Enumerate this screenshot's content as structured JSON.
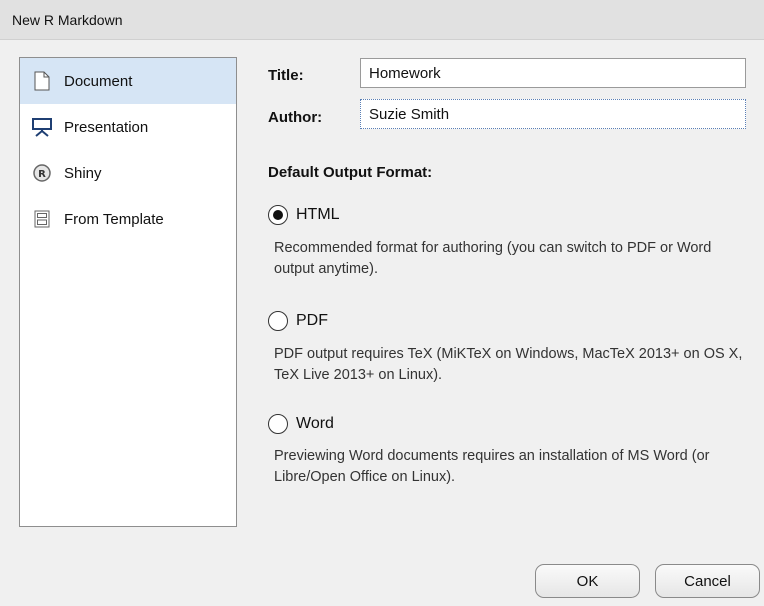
{
  "window": {
    "title": "New R Markdown"
  },
  "sidebar": {
    "items": [
      {
        "label": "Document",
        "icon": "document-icon",
        "selected": true
      },
      {
        "label": "Presentation",
        "icon": "presentation-icon",
        "selected": false
      },
      {
        "label": "Shiny",
        "icon": "shiny-r-icon",
        "selected": false
      },
      {
        "label": "From Template",
        "icon": "template-icon",
        "selected": false
      }
    ]
  },
  "form": {
    "title_label": "Title:",
    "title_value": "Homework",
    "author_label": "Author:",
    "author_value": "Suzie Smith"
  },
  "output": {
    "heading": "Default Output Format:",
    "options": [
      {
        "label": "HTML",
        "selected": true,
        "description": "Recommended format for authoring (you can switch to PDF or Word output anytime)."
      },
      {
        "label": "PDF",
        "selected": false,
        "description": "PDF output requires TeX (MiKTeX on Windows, MacTeX 2013+ on OS X, TeX Live 2013+ on Linux)."
      },
      {
        "label": "Word",
        "selected": false,
        "description": "Previewing Word documents requires an installation of MS Word (or Libre/Open Office on Linux)."
      }
    ]
  },
  "buttons": {
    "ok": "OK",
    "cancel": "Cancel"
  },
  "colors": {
    "selection": "#d6e5f5",
    "accent_icon": "#1f3f73"
  }
}
